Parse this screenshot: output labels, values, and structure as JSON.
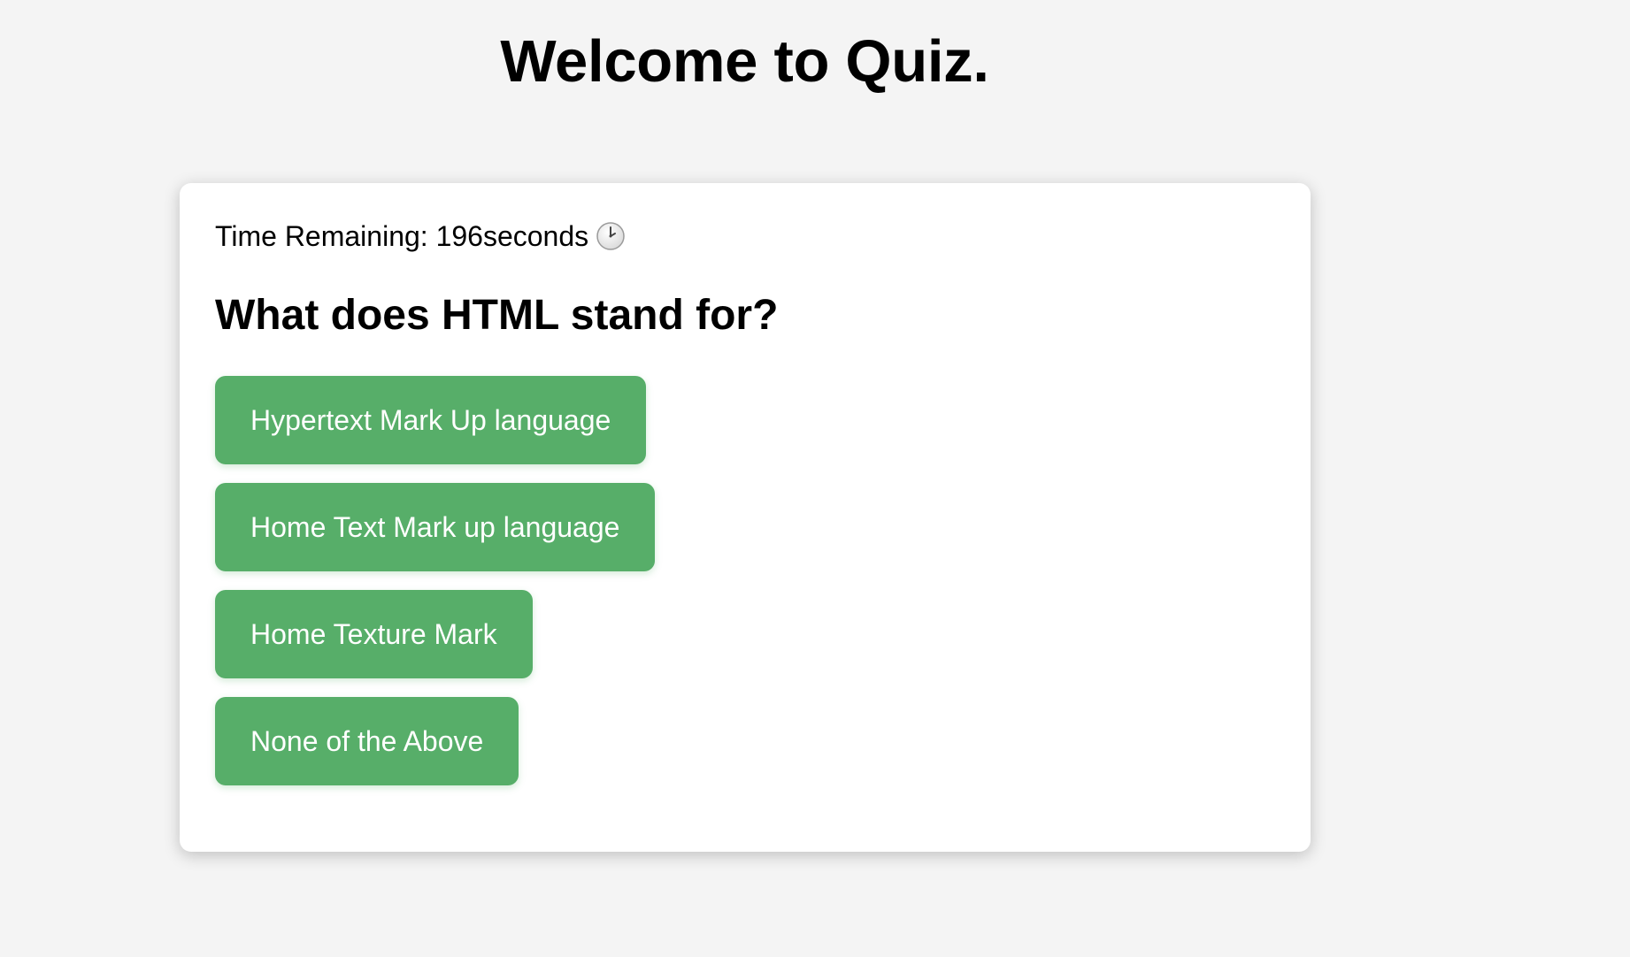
{
  "header": {
    "title": "Welcome to Quiz."
  },
  "quiz": {
    "timer_text": "Time Remaining: 196seconds",
    "timer_icon": "clock-icon",
    "question": "What does HTML stand for?",
    "answers": [
      "Hypertext Mark Up language",
      "Home Text Mark up language",
      "Home Texture Mark",
      "None of the Above"
    ]
  },
  "colors": {
    "background": "#f4f4f4",
    "card": "#ffffff",
    "button": "#57ae69",
    "button_text": "#ffffff"
  }
}
